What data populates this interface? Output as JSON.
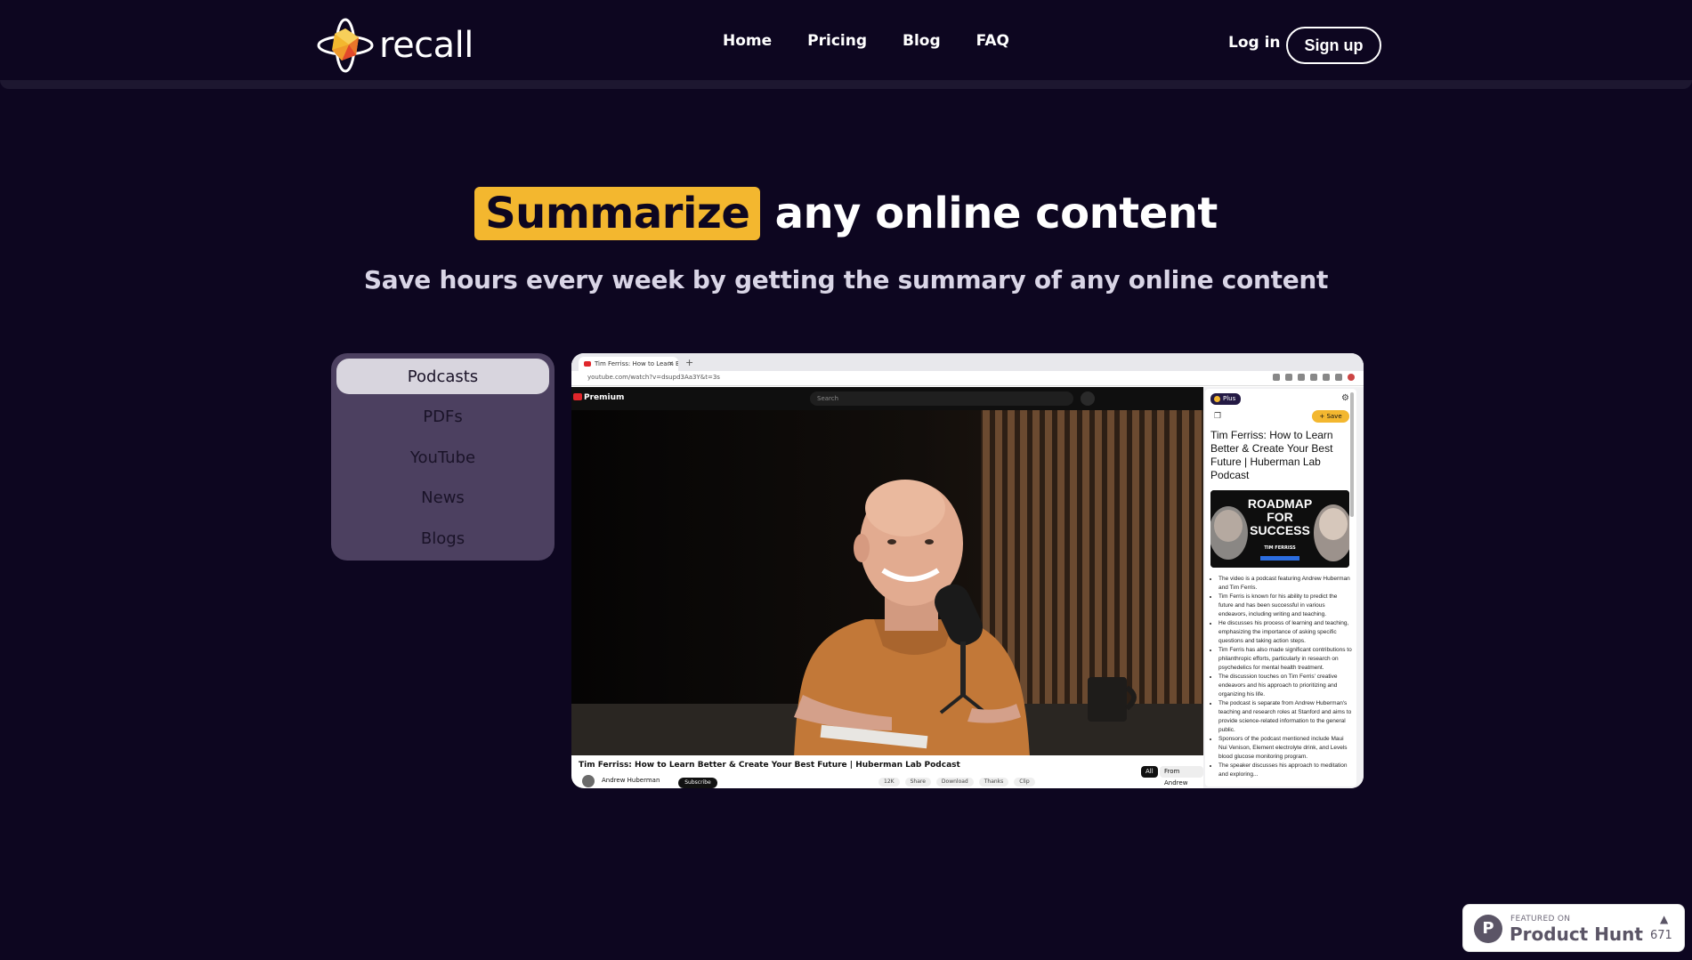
{
  "header": {
    "logo_text": "recall",
    "nav": [
      "Home",
      "Pricing",
      "Blog",
      "FAQ"
    ],
    "login_label": "Log in",
    "signup_label": "Sign up"
  },
  "hero": {
    "highlight": "Summarize",
    "title_rest": " any online content",
    "subtitle": "Save hours every week by getting the summary of any online content"
  },
  "categories": {
    "items": [
      "Podcasts",
      "PDFs",
      "YouTube",
      "News",
      "Blogs"
    ],
    "active": "Podcasts"
  },
  "browser": {
    "tab_title": "Tim Ferriss: How to Learn Bett",
    "url": "youtube.com/watch?v=dsupd3Aa3Y&t=3s",
    "yt_logo": "Premium",
    "search_placeholder": "Search",
    "video_title": "Tim Ferriss: How to Learn Better & Create Your Best Future | Huberman Lab Podcast",
    "channel": "Andrew Huberman",
    "subscribe": "Subscribe",
    "actions": [
      "12K",
      "Share",
      "Download",
      "Thanks",
      "Clip"
    ],
    "chip_all": "All",
    "chip_from": "From Andrew"
  },
  "recall_panel": {
    "badge": "Plus",
    "save_label": "Save",
    "title": "Tim Ferriss: How to Learn Better & Create Your Best Future | Huberman Lab Podcast",
    "thumb_text": "ROADMAP FOR SUCCESS",
    "thumb_sub": "TIM FERRISS",
    "bullets": [
      "The video is a podcast featuring Andrew Huberman and Tim Ferris.",
      "Tim Ferris is known for his ability to predict the future and has been successful in various endeavors, including writing and teaching.",
      "He discusses his process of learning and teaching, emphasizing the importance of asking specific questions and taking action steps.",
      "Tim Ferris has also made significant contributions to philanthropic efforts, particularly in research on psychedelics for mental health treatment.",
      "The discussion touches on Tim Ferris' creative endeavors and his approach to prioritizing and organizing his life.",
      "The podcast is separate from Andrew Huberman's teaching and research roles at Stanford and aims to provide science-related information to the general public.",
      "Sponsors of the podcast mentioned include Maui Nui Venison, Element electrolyte drink, and Levels blood glucose monitoring program.",
      "The speaker discusses his approach to meditation and exploring..."
    ]
  },
  "product_hunt": {
    "featured": "FEATURED ON",
    "name": "Product Hunt",
    "count": "671"
  },
  "colors": {
    "background": "#0d0620",
    "accent": "#f3b72f",
    "panel": "#4c4060"
  }
}
